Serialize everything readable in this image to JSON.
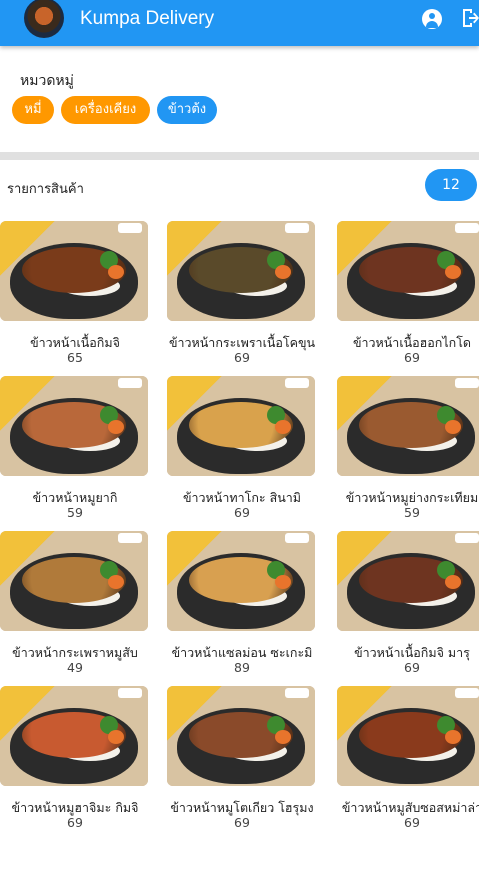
{
  "app": {
    "title": "Kumpa Delivery"
  },
  "icons": {
    "account": "account-circle-icon",
    "logout": "logout-icon"
  },
  "colors": {
    "primary": "#2196f3",
    "chip_orange": "#ff9800"
  },
  "categories": {
    "label": "หมวดหมู่",
    "chips": [
      {
        "label": "หมี่",
        "color": "#ff9800",
        "selected": false
      },
      {
        "label": "เครื่องเคียง",
        "color": "#ff9800",
        "selected": false
      },
      {
        "label": "ข้าวต้ง",
        "color": "#2196f3",
        "selected": true
      }
    ]
  },
  "products": {
    "label": "รายการสินค้า",
    "count": "12",
    "items": [
      {
        "name": "ข้าวหน้าเนื้อกิมจิ",
        "price": "65",
        "food": "#7a3b1a"
      },
      {
        "name": "ข้าวหน้ากระเพราเนื้อโคขุน",
        "price": "69",
        "food": "#5a4a2a"
      },
      {
        "name": "ข้าวหน้าเนื้อฮอกไกโด",
        "price": "69",
        "food": "#6e3420"
      },
      {
        "name": "ข้าวหน้าหมูยากิ",
        "price": "59",
        "food": "#b9683a"
      },
      {
        "name": "ข้าวหน้าทาโกะ สินามิ",
        "price": "69",
        "food": "#d9a24c"
      },
      {
        "name": "ข้าวหน้าหมูย่างกระเทียม",
        "price": "59",
        "food": "#9a5a30"
      },
      {
        "name": "ข้าวหน้ากระเพราหมูสับ",
        "price": "49",
        "food": "#b07a3a"
      },
      {
        "name": "ข้าวหน้าแซลม่อน ซะเกะมิ",
        "price": "89",
        "food": "#d8a050"
      },
      {
        "name": "ข้าวหน้าเนื้อกิมจิ มารุ",
        "price": "69",
        "food": "#6e3420"
      },
      {
        "name": "ข้าวหน้าหมูฮาจิมะ กิมจิ",
        "price": "69",
        "food": "#c85a30"
      },
      {
        "name": "ข้าวหน้าหมูโตเกียว โฮรุมง",
        "price": "69",
        "food": "#8a4a2a"
      },
      {
        "name": "ข้าวหน้าหมูสับซอสหม่าล่า",
        "price": "69",
        "food": "#8a3a1c"
      }
    ]
  }
}
